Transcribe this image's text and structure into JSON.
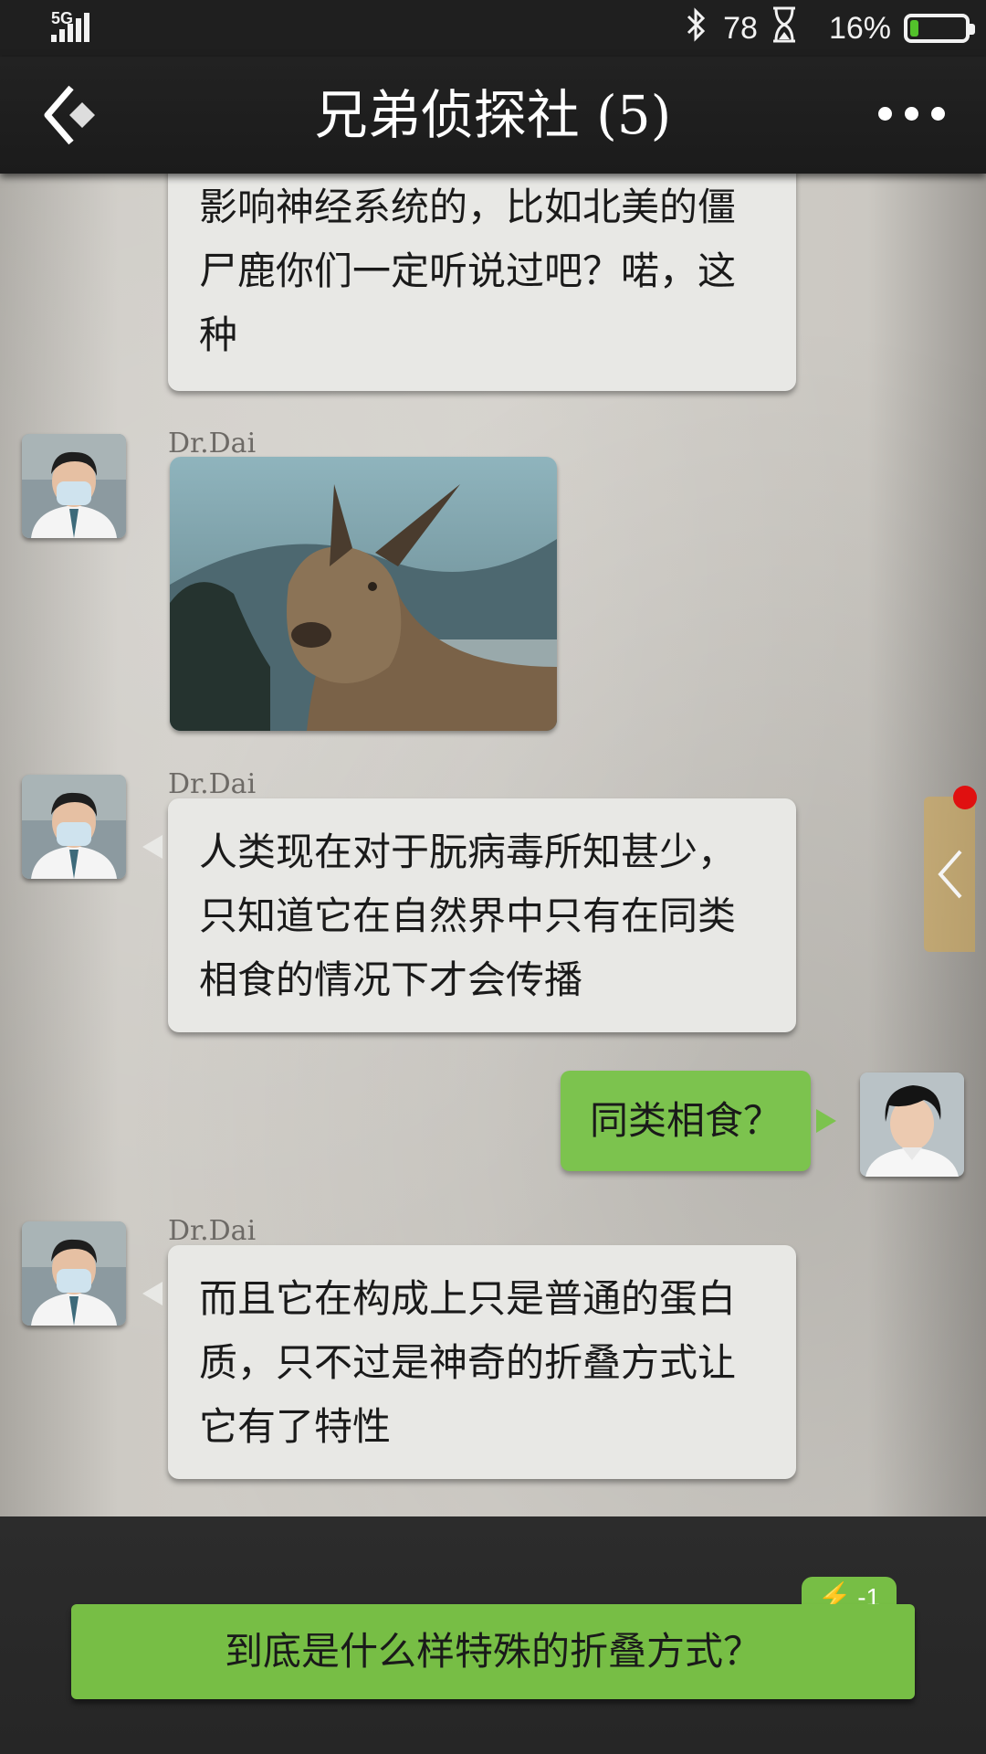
{
  "status_bar": {
    "network": "5G",
    "bluetooth_icon": "bluetooth-icon",
    "stamina": "78",
    "hourglass_icon": "hourglass-icon",
    "battery": "16%",
    "battery_level": 0.16
  },
  "header": {
    "back_icon": "back-arrow-icon",
    "title": "兄弟侦探社 (5)",
    "more_icon": "more-dots-icon"
  },
  "messages": {
    "m0": {
      "lines": [
        "影响神经系统的，比如北美的僵",
        "尸鹿你们一定听说过吧？喏，这",
        "种"
      ]
    },
    "m1": {
      "sender": "Dr.Dai",
      "image": "deer-photo"
    },
    "m2": {
      "sender": "Dr.Dai",
      "lines": [
        "人类现在对于朊病毒所知甚少，",
        "只知道它在自然界中只有在同类",
        "相食的情况下才会传播"
      ]
    },
    "m3": {
      "sender": "self",
      "text": "同类相食？"
    },
    "m4": {
      "sender": "Dr.Dai",
      "lines": [
        "而且它在构成上只是普通的蛋白",
        "质，只不过是神奇的折叠方式让",
        "它有了特性"
      ]
    }
  },
  "choice": {
    "text": "到底是什么样特殊的折叠方式？",
    "cost": "-1",
    "cost_icon": "lightning-icon"
  },
  "colors": {
    "accent_green": "#77be45",
    "bubble_gray": "#e8e8e5",
    "notification_red": "#e01010"
  }
}
